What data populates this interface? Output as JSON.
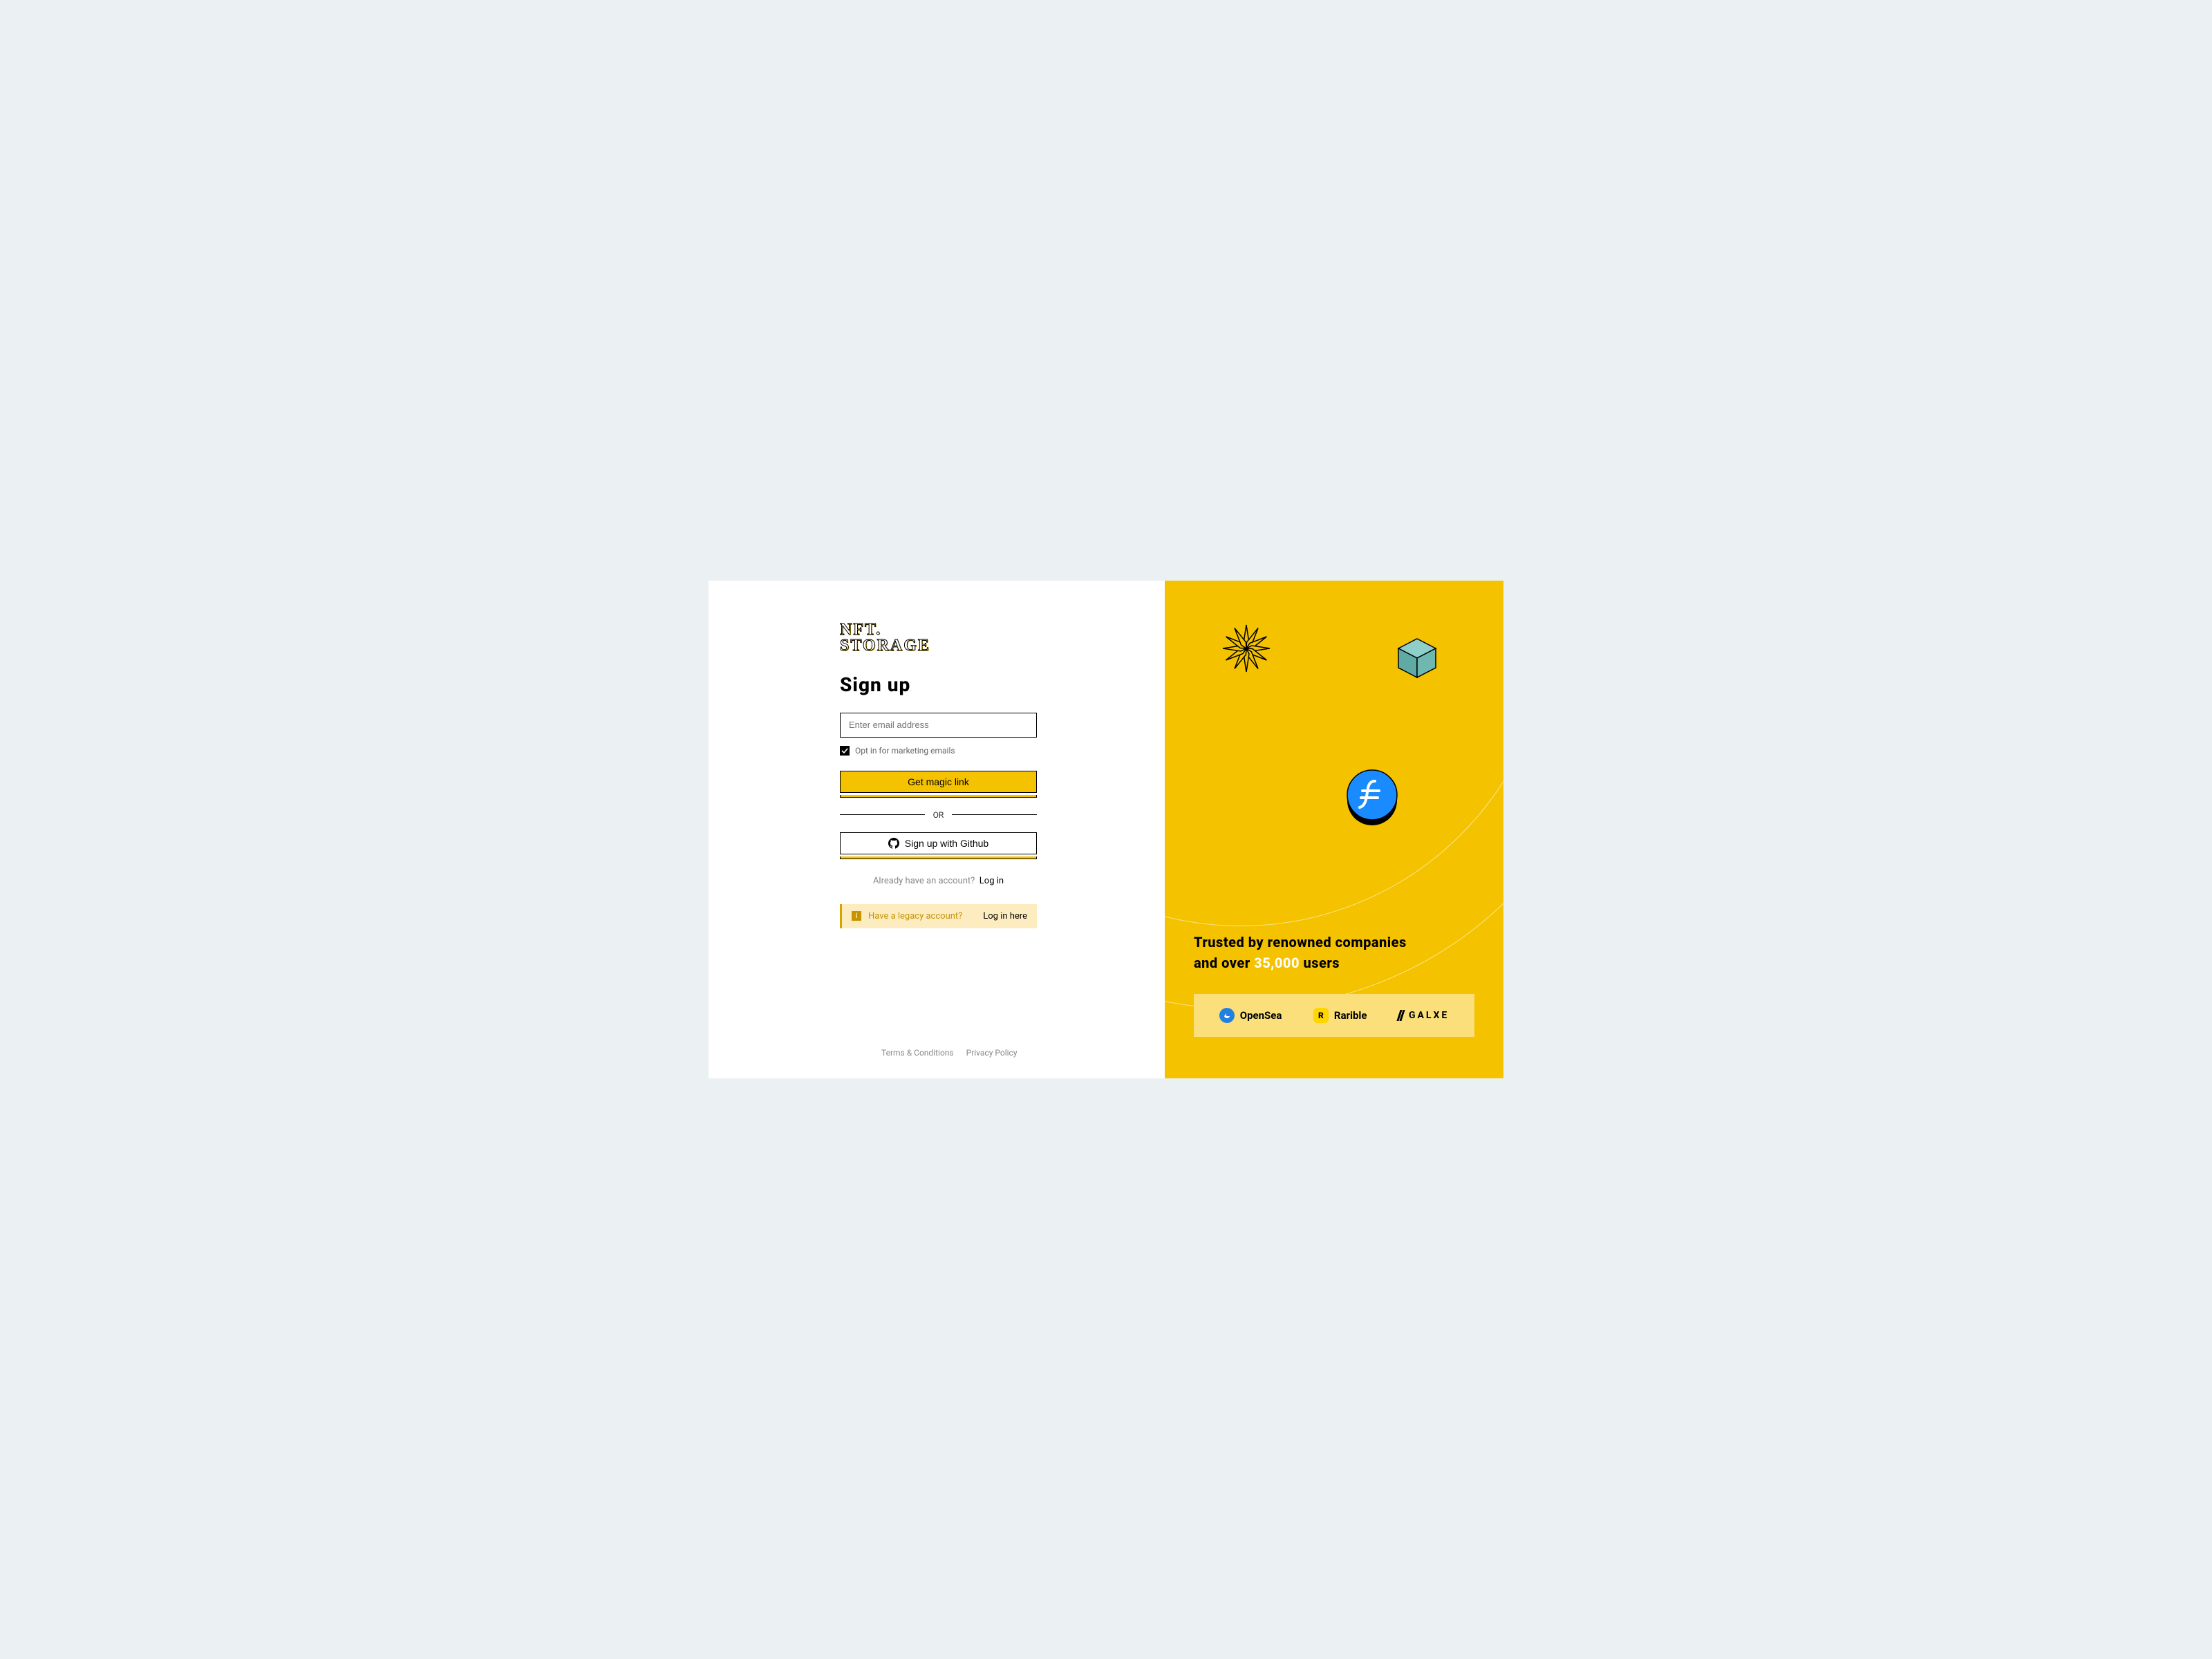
{
  "logo": {
    "line1": "NFT.",
    "line2": "STORAGE"
  },
  "signup": {
    "title": "Sign up",
    "email_placeholder": "Enter email address",
    "marketing_checkbox_label": "Opt in for marketing emails",
    "magic_link_button": "Get magic link",
    "divider_text": "OR",
    "github_button": "Sign up with Github",
    "login_prompt": "Already have an account?",
    "login_link": "Log in"
  },
  "legacy": {
    "question": "Have a legacy account?",
    "link": "Log in here"
  },
  "footer": {
    "terms": "Terms & Conditions",
    "privacy": "Privacy Policy"
  },
  "trust": {
    "line1": "Trusted by renowned companies",
    "line2a": "and over ",
    "count": "35,000",
    "line2b": " users"
  },
  "companies": {
    "opensea": "OpenSea",
    "rarible": "Rarible",
    "rarible_icon_letter": "R",
    "galxe": "GALXE"
  }
}
